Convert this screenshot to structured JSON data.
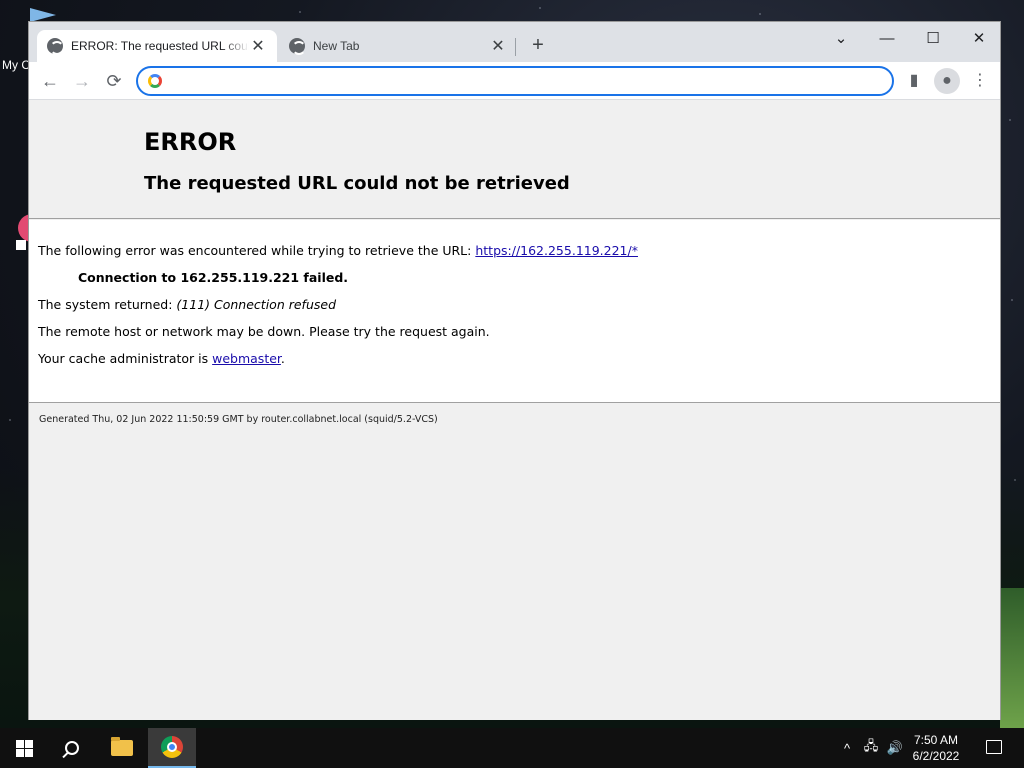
{
  "desktop": {
    "label_fragment": "My C"
  },
  "browser": {
    "tabs": [
      {
        "title": "ERROR: The requested URL could not be retrieved",
        "close": "✕"
      },
      {
        "title": "New Tab",
        "close": "✕"
      }
    ],
    "new_tab_glyph": "+",
    "window_controls": {
      "dropdown": "⌄",
      "minimize": "—",
      "maximize": "☐",
      "close": "✕"
    },
    "nav": {
      "back": "←",
      "forward": "→",
      "reload": "⟳"
    },
    "omnibox": {
      "value": "",
      "placeholder": ""
    },
    "right_tools": {
      "side_panel": "▮",
      "profile": "●",
      "menu": "⋮"
    }
  },
  "page": {
    "title": "ERROR",
    "subtitle": "The requested URL could not be retrieved",
    "line1_text": "The following error was encountered while trying to retrieve the URL: ",
    "line1_link": "https://162.255.119.221/*",
    "line2_bold": "Connection to 162.255.119.221 failed.",
    "line3_text": "The system returned: ",
    "line3_italic": "(111) Connection refused",
    "line4_text": "The remote host or network may be down. Please try the request again.",
    "line5_text": "Your cache administrator is ",
    "line5_link": "webmaster",
    "line5_end": ".",
    "footer": "Generated Thu, 02 Jun 2022 11:50:59 GMT by router.collabnet.local (squid/5.2-VCS)"
  },
  "taskbar": {
    "tray": {
      "chevron": "^",
      "network": "🖧",
      "volume": "🔊"
    },
    "time": "7:50 AM",
    "date": "6/2/2022"
  }
}
